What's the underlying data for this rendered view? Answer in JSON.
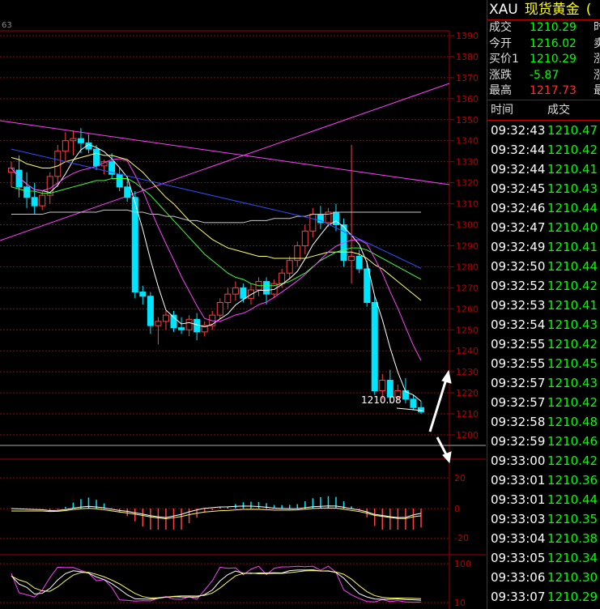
{
  "colors": {
    "up": "#ff4040",
    "down": "#00e5ff",
    "grid": "#a00000",
    "green_text": "#00ff00",
    "red_text": "#ff3030",
    "label_yellow": "#ffff00"
  },
  "chart": {
    "corner_label": "63",
    "price_axis": [
      "1390",
      "1380",
      "1370",
      "1360",
      "1350",
      "1340",
      "1330",
      "1320",
      "1310",
      "1300",
      "1290",
      "1280",
      "1270",
      "1260",
      "1250",
      "1240",
      "1230",
      "1220",
      "1210",
      "1200"
    ],
    "last_price_label": "1210.08",
    "macd_axis": [
      "20",
      "0",
      "-20"
    ],
    "kdj_axis": [
      "100",
      "10"
    ]
  },
  "chart_data": {
    "type": "candlestick",
    "ylim": [
      1195,
      1395
    ],
    "candles": [
      [
        1325,
        1330,
        1318,
        1327
      ],
      [
        1326,
        1333,
        1313,
        1318
      ],
      [
        1318,
        1325,
        1308,
        1313
      ],
      [
        1313,
        1320,
        1305,
        1309
      ],
      [
        1309,
        1316,
        1307,
        1314
      ],
      [
        1314,
        1325,
        1310,
        1323
      ],
      [
        1323,
        1338,
        1318,
        1335
      ],
      [
        1335,
        1344,
        1330,
        1340
      ],
      [
        1340,
        1345,
        1333,
        1341
      ],
      [
        1341,
        1346,
        1334,
        1339
      ],
      [
        1339,
        1343,
        1334,
        1336
      ],
      [
        1336,
        1338,
        1326,
        1328
      ],
      [
        1328,
        1331,
        1324,
        1330
      ],
      [
        1330,
        1334,
        1322,
        1324
      ],
      [
        1324,
        1327,
        1316,
        1318
      ],
      [
        1318,
        1323,
        1311,
        1313
      ],
      [
        1313,
        1316,
        1265,
        1268
      ],
      [
        1268,
        1271,
        1262,
        1266
      ],
      [
        1266,
        1268,
        1248,
        1252
      ],
      [
        1252,
        1256,
        1243,
        1254
      ],
      [
        1254,
        1259,
        1250,
        1257
      ],
      [
        1257,
        1259,
        1249,
        1251
      ],
      [
        1251,
        1256,
        1248,
        1250
      ],
      [
        1250,
        1257,
        1247,
        1255
      ],
      [
        1255,
        1258,
        1245,
        1249
      ],
      [
        1249,
        1254,
        1247,
        1252
      ],
      [
        1252,
        1259,
        1250,
        1257
      ],
      [
        1257,
        1265,
        1255,
        1263
      ],
      [
        1263,
        1270,
        1260,
        1267
      ],
      [
        1267,
        1273,
        1264,
        1270
      ],
      [
        1270,
        1272,
        1263,
        1265
      ],
      [
        1265,
        1272,
        1262,
        1269
      ],
      [
        1269,
        1275,
        1266,
        1273
      ],
      [
        1273,
        1275,
        1262,
        1267
      ],
      [
        1267,
        1274,
        1265,
        1272
      ],
      [
        1272,
        1279,
        1270,
        1277
      ],
      [
        1277,
        1285,
        1274,
        1283
      ],
      [
        1283,
        1292,
        1280,
        1290
      ],
      [
        1290,
        1300,
        1286,
        1297
      ],
      [
        1297,
        1308,
        1294,
        1305
      ],
      [
        1305,
        1309,
        1298,
        1301
      ],
      [
        1301,
        1308,
        1299,
        1306
      ],
      [
        1306,
        1310,
        1297,
        1300
      ],
      [
        1300,
        1303,
        1280,
        1283
      ],
      [
        1283,
        1338,
        1272,
        1285
      ],
      [
        1285,
        1288,
        1277,
        1279
      ],
      [
        1279,
        1283,
        1261,
        1263
      ],
      [
        1263,
        1266,
        1219,
        1221
      ],
      [
        1221,
        1229,
        1217,
        1226
      ],
      [
        1226,
        1231,
        1215,
        1218
      ],
      [
        1218,
        1224,
        1216,
        1221
      ],
      [
        1221,
        1227,
        1215,
        1217
      ],
      [
        1217,
        1219,
        1212,
        1213
      ],
      [
        1213,
        1216,
        1210,
        1211
      ]
    ],
    "series": [
      {
        "values": [
          1332,
          1331,
          1329,
          1328,
          1327,
          1327,
          1328,
          1330,
          1331,
          1332,
          1333,
          1334,
          1333,
          1333,
          1332,
          1331,
          1328,
          1325,
          1321,
          1317,
          1313,
          1310,
          1306,
          1302,
          1299,
          1296,
          1293,
          1291,
          1289,
          1288,
          1287,
          1286,
          1285,
          1285,
          1284,
          1284,
          1284,
          1284,
          1284,
          1285,
          1286,
          1287,
          1287,
          1287,
          1287,
          1286,
          1284,
          1281,
          1279,
          1276,
          1273,
          1270,
          1267,
          1264
        ]
      },
      {
        "values": [
          1318,
          1317,
          1316,
          1316,
          1315,
          1315,
          1316,
          1317,
          1318,
          1319,
          1320,
          1321,
          1321,
          1322,
          1322,
          1322,
          1320,
          1317,
          1314,
          1310,
          1306,
          1302,
          1298,
          1294,
          1290,
          1286,
          1283,
          1280,
          1277,
          1275,
          1274,
          1272,
          1271,
          1271,
          1271,
          1272,
          1273,
          1275,
          1277,
          1280,
          1283,
          1285,
          1287,
          1288,
          1289,
          1289,
          1288,
          1286,
          1284,
          1282,
          1280,
          1278,
          1276,
          1274
        ]
      },
      {
        "values": [
          1305,
          1305,
          1305,
          1305,
          1305,
          1306,
          1306,
          1306,
          1306,
          1306,
          1306,
          1306,
          1307,
          1307,
          1307,
          1307,
          1306,
          1306,
          1305,
          1305,
          1304,
          1304,
          1303,
          1302,
          1302,
          1301,
          1301,
          1301,
          1301,
          1301,
          1301,
          1302,
          1302,
          1302,
          1303,
          1303,
          1303,
          1304,
          1304,
          1305,
          1305,
          1305,
          1306,
          1306,
          1306,
          1306,
          1306,
          1306,
          1306,
          1306,
          1306,
          1306,
          1306,
          1306
        ]
      }
    ]
  },
  "quote": {
    "symbol": "XAU",
    "name": "现货黄金",
    "extra": "(",
    "rows": [
      {
        "label": "成交",
        "value": "1210.29",
        "label2": "时",
        "color": "green"
      },
      {
        "label": "今开",
        "value": "1216.02",
        "label2": "卖",
        "color": "green"
      },
      {
        "label": "买价1",
        "value": "1210.29",
        "label2": "涨",
        "color": "green"
      },
      {
        "label": "涨跌",
        "value": "-5.87",
        "label2": "涨",
        "color": "green"
      },
      {
        "label": "最高",
        "value": "1217.73",
        "label2": "最",
        "color": "red"
      }
    ]
  },
  "ticks": {
    "header_time": "时间",
    "header_price": "成交",
    "rows": [
      {
        "time": "09:32:43",
        "price": "1210.47"
      },
      {
        "time": "09:32:44",
        "price": "1210.42"
      },
      {
        "time": "09:32:44",
        "price": "1210.41"
      },
      {
        "time": "09:32:45",
        "price": "1210.43"
      },
      {
        "time": "09:32:46",
        "price": "1210.44"
      },
      {
        "time": "09:32:47",
        "price": "1210.40"
      },
      {
        "time": "09:32:49",
        "price": "1210.41"
      },
      {
        "time": "09:32:50",
        "price": "1210.44"
      },
      {
        "time": "09:32:52",
        "price": "1210.42"
      },
      {
        "time": "09:32:53",
        "price": "1210.41"
      },
      {
        "time": "09:32:54",
        "price": "1210.43"
      },
      {
        "time": "09:32:55",
        "price": "1210.42"
      },
      {
        "time": "09:32:55",
        "price": "1210.45"
      },
      {
        "time": "09:32:57",
        "price": "1210.43"
      },
      {
        "time": "09:32:57",
        "price": "1210.42"
      },
      {
        "time": "09:32:58",
        "price": "1210.48"
      },
      {
        "time": "09:32:59",
        "price": "1210.46"
      },
      {
        "time": "09:33:00",
        "price": "1210.42"
      },
      {
        "time": "09:33:01",
        "price": "1210.36"
      },
      {
        "time": "09:33:01",
        "price": "1210.44"
      },
      {
        "time": "09:33:03",
        "price": "1210.35"
      },
      {
        "time": "09:33:04",
        "price": "1210.38"
      },
      {
        "time": "09:33:05",
        "price": "1210.34"
      },
      {
        "time": "09:33:06",
        "price": "1210.30"
      },
      {
        "time": "09:33:07",
        "price": "1210.29"
      }
    ]
  }
}
